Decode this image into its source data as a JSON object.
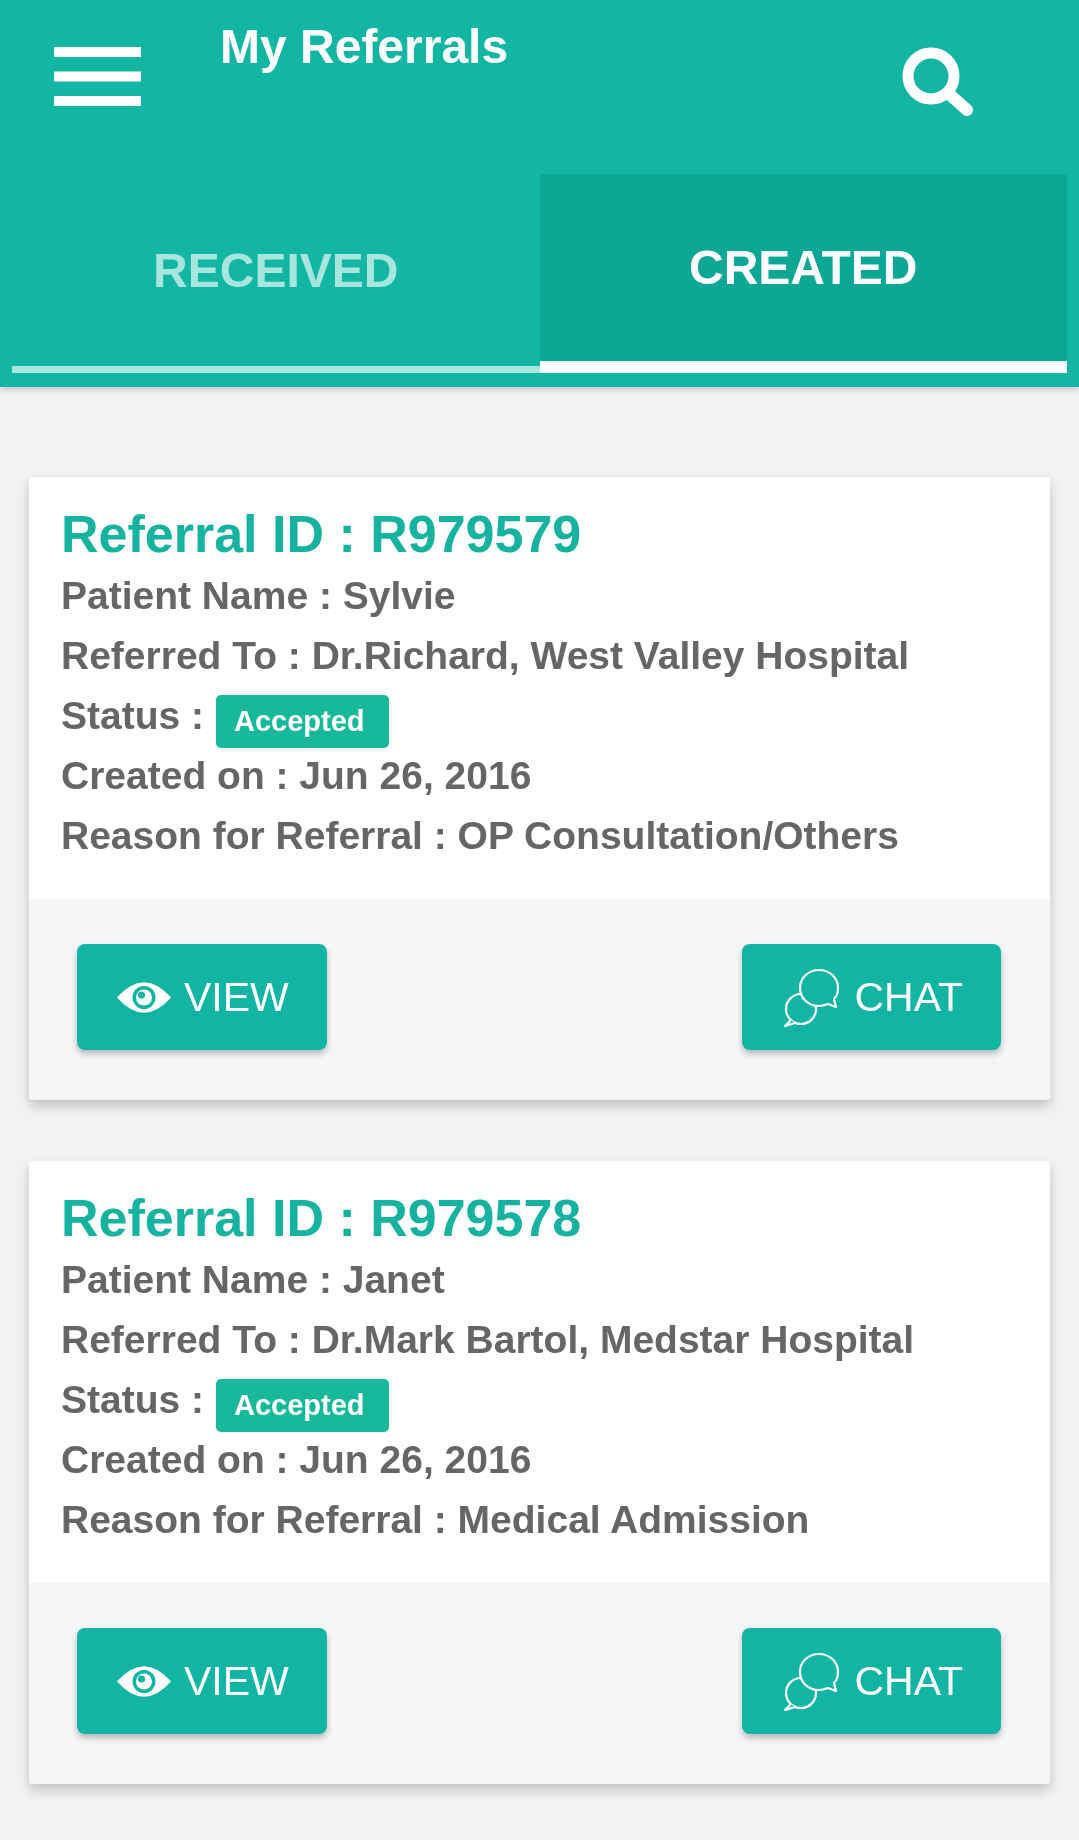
{
  "app_bar": {
    "title": "My Referrals"
  },
  "tabs": [
    {
      "label": "RECEIVED",
      "selected": false
    },
    {
      "label": "CREATED",
      "selected": true
    }
  ],
  "referrals": [
    {
      "referral_id": "Referral ID : R979579",
      "patient_name": "Patient Name : Sylvie",
      "referred_to": "Referred To : Dr.Richard, West Valley Hospital",
      "status_label": "Status :",
      "status": "Accepted",
      "created_on": "Created on : Jun 26, 2016",
      "reason": "Reason for Referral : OP Consultation/Others",
      "buttons": [
        {
          "kind": "view",
          "label": "VIEW"
        },
        {
          "kind": "chat",
          "label": "CHAT"
        }
      ]
    },
    {
      "referral_id": "Referral ID : R979578",
      "patient_name": "Patient Name : Janet",
      "referred_to": "Referred To : Dr.Mark Bartol, Medstar Hospital",
      "status_label": "Status :",
      "status": "Accepted",
      "created_on": "Created on : Jun 26, 2016",
      "reason": "Reason for Referral : Medical Admission",
      "buttons": [
        {
          "kind": "view",
          "label": "VIEW"
        },
        {
          "kind": "chat",
          "label": "CHAT"
        }
      ]
    }
  ]
}
